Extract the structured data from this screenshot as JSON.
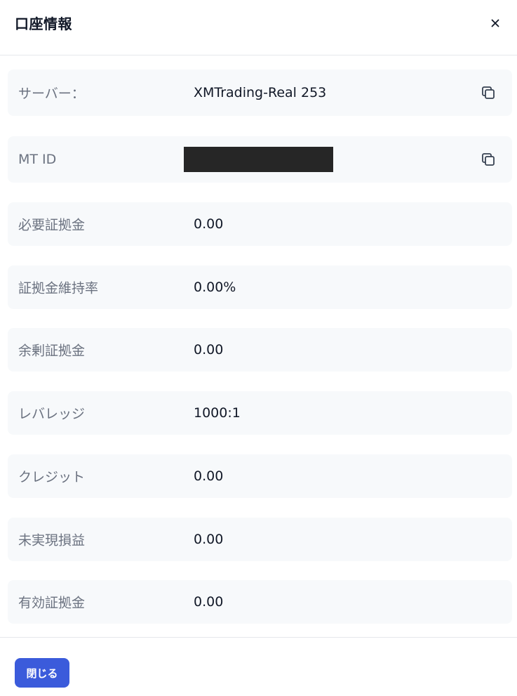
{
  "dialog": {
    "title": "口座情報",
    "close_icon": "close-icon"
  },
  "rows": [
    {
      "key": "server",
      "label": "サーバー：",
      "value": "XMTrading-Real 253",
      "copyable": true
    },
    {
      "key": "mt-id",
      "label": "MT ID",
      "value": "",
      "redacted": true,
      "copyable": true
    },
    {
      "key": "required-margin",
      "label": "必要証拠金",
      "value": "0.00"
    },
    {
      "key": "margin-level",
      "label": "証拠金維持率",
      "value": "0.00%"
    },
    {
      "key": "free-margin",
      "label": "余剰証拠金",
      "value": "0.00"
    },
    {
      "key": "leverage",
      "label": "レバレッジ",
      "value": "1000:1"
    },
    {
      "key": "credit",
      "label": "クレジット",
      "value": "0.00"
    },
    {
      "key": "unrealized-pnl",
      "label": "未実現損益",
      "value": "0.00"
    },
    {
      "key": "effective-margin",
      "label": "有効証拠金",
      "value": "0.00"
    }
  ],
  "footer": {
    "close_label": "閉じる"
  },
  "colors": {
    "primary_button": "#3b5bdb",
    "row_background": "#f7f9fb",
    "label_text": "#6b7280",
    "value_text": "#111827"
  }
}
